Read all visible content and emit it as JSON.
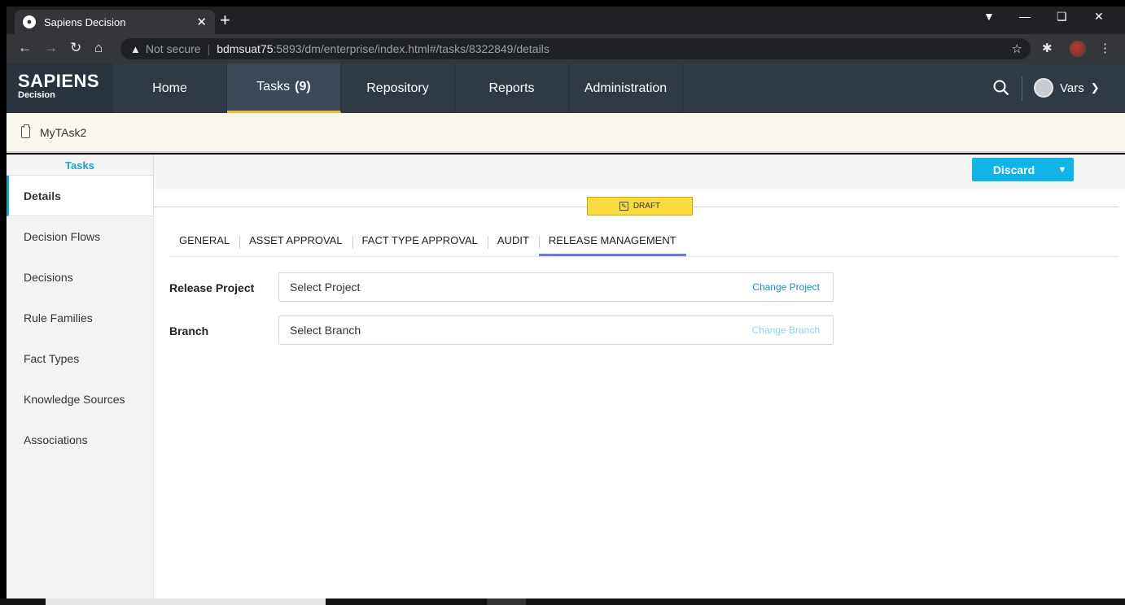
{
  "browser": {
    "tab_title": "Sapiens Decision",
    "new_tab": "+",
    "security": "Not secure",
    "url_host": "bdmsuat75",
    "url_rest": ":5893/dm/enterprise/index.html#/tasks/8322849/details"
  },
  "app": {
    "logo_main": "SAPIENS",
    "logo_sub": "Decision",
    "nav": [
      {
        "label": "Home"
      },
      {
        "label": "Tasks",
        "count": "(9)"
      },
      {
        "label": "Repository"
      },
      {
        "label": "Reports"
      },
      {
        "label": "Administration"
      }
    ],
    "user": "Vars"
  },
  "task": {
    "name": "MyTAsk2"
  },
  "sidebar": {
    "title": "Tasks",
    "items": [
      {
        "label": "Details"
      },
      {
        "label": "Decision Flows"
      },
      {
        "label": "Decisions"
      },
      {
        "label": "Rule Families"
      },
      {
        "label": "Fact Types"
      },
      {
        "label": "Knowledge Sources"
      },
      {
        "label": "Associations"
      }
    ]
  },
  "main": {
    "discard_label": "Discard",
    "status": "DRAFT",
    "tabs": [
      {
        "label": "GENERAL"
      },
      {
        "label": "ASSET APPROVAL"
      },
      {
        "label": "FACT TYPE APPROVAL"
      },
      {
        "label": "AUDIT"
      },
      {
        "label": "RELEASE MANAGEMENT"
      }
    ],
    "release_project": {
      "label": "Release Project",
      "value": "Select Project",
      "action": "Change Project"
    },
    "branch": {
      "label": "Branch",
      "value": "Select Branch",
      "action": "Change Branch"
    }
  },
  "colors": {
    "accent": "#1aa3c9",
    "header_bg": "#2f3a45",
    "active_nav_underline": "#f2c027",
    "draft_badge": "#f9db3d",
    "discard_button": "#12b4e6",
    "active_tab_underline": "#6d7ae0"
  }
}
